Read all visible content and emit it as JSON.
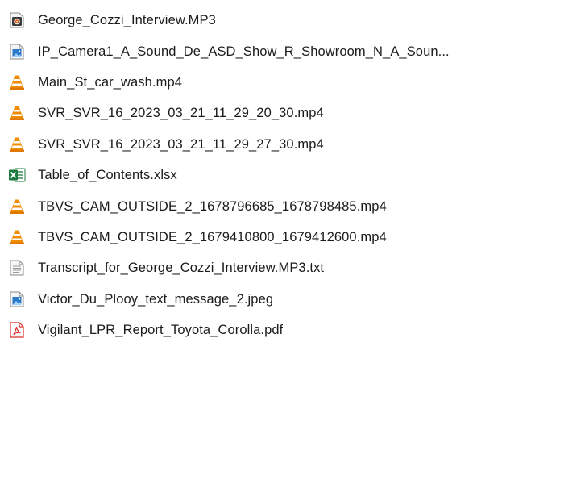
{
  "files": [
    {
      "name": "George_Cozzi_Interview.MP3",
      "icon": "audio-file-icon"
    },
    {
      "name": "IP_Camera1_A_Sound_De_ASD_Show_R_Showroom_N_A_Soun...",
      "icon": "image-file-icon"
    },
    {
      "name": "Main_St_car_wash.mp4",
      "icon": "vlc-cone-icon"
    },
    {
      "name": "SVR_SVR_16_2023_03_21_11_29_20_30.mp4",
      "icon": "vlc-cone-icon"
    },
    {
      "name": "SVR_SVR_16_2023_03_21_11_29_27_30.mp4",
      "icon": "vlc-cone-icon"
    },
    {
      "name": "Table_of_Contents.xlsx",
      "icon": "excel-file-icon"
    },
    {
      "name": "TBVS_CAM_OUTSIDE_2_1678796685_1678798485.mp4",
      "icon": "vlc-cone-icon"
    },
    {
      "name": "TBVS_CAM_OUTSIDE_2_1679410800_1679412600.mp4",
      "icon": "vlc-cone-icon"
    },
    {
      "name": "Transcript_for_George_Cozzi_Interview.MP3.txt",
      "icon": "text-file-icon"
    },
    {
      "name": "Victor_Du_Plooy_text_message_2.jpeg",
      "icon": "image-file-icon"
    },
    {
      "name": "Vigilant_LPR_Report_Toyota_Corolla.pdf",
      "icon": "pdf-file-icon"
    }
  ],
  "colors": {
    "vlc_orange": "#f08c00",
    "excel_green": "#1d7a3e",
    "pdf_red": "#d9312a",
    "image_blue": "#2b79c8"
  }
}
